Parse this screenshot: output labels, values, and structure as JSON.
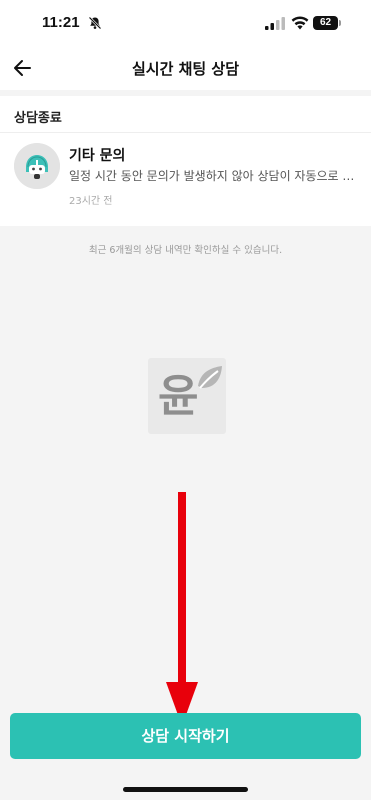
{
  "status_bar": {
    "time": "11:21",
    "battery": "62"
  },
  "header": {
    "title": "실시간 채팅 상담"
  },
  "section": {
    "title": "상담종료",
    "items": [
      {
        "title": "기타 문의",
        "preview": "일정 시간 동안 문의가 발생하지 않아 상담이 자동으로 종료되었습니다.",
        "time": "23시간 전"
      }
    ]
  },
  "notice": "최근 6개월의 상담 내역만 확인하실 수 있습니다.",
  "watermark": {
    "text": "윤"
  },
  "start_button": {
    "label": "상담 시작하기"
  },
  "colors": {
    "accent": "#2cc1b3",
    "annotation_arrow": "#e8000b"
  }
}
